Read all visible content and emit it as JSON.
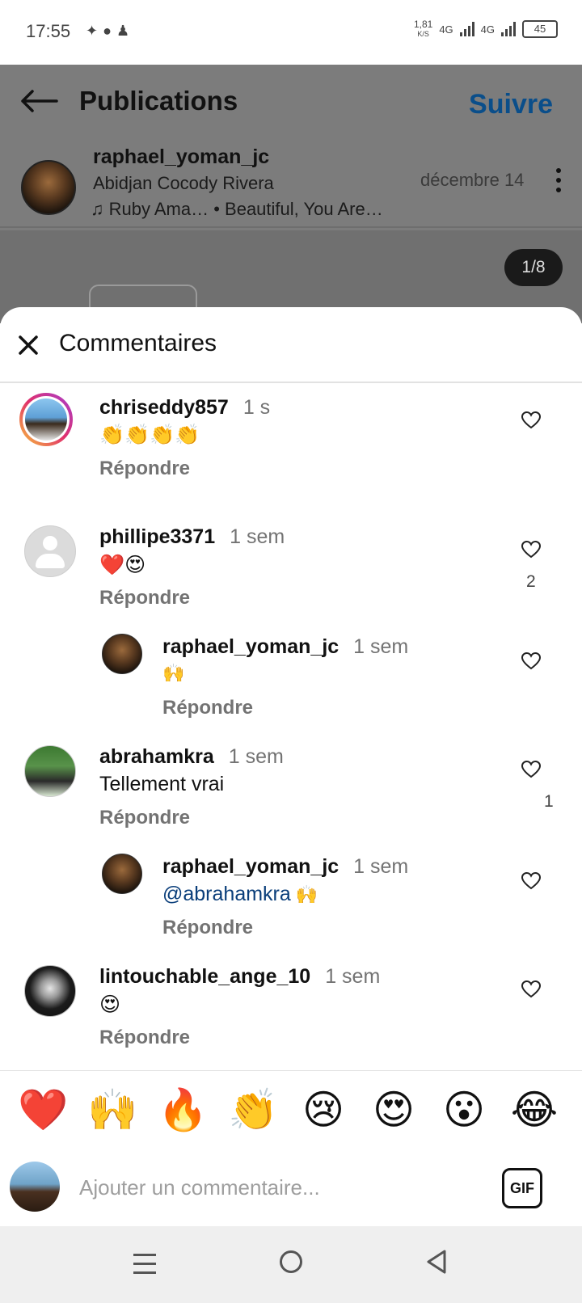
{
  "status_bar": {
    "time": "17:55",
    "left_icons": [
      "android-icon",
      "chat-bubble-icon",
      "snapchat-icon"
    ],
    "speed_value": "1,81",
    "speed_unit": "K/S",
    "network1": "4G",
    "network2": "4G",
    "battery": "45"
  },
  "header": {
    "title": "Publications",
    "follow_label": "Suivre"
  },
  "post": {
    "username": "raphael_yoman_jc",
    "location": "Abidjan Cocody Rivera",
    "music": "♫ Ruby Ama…  •  Beautiful, You Are…",
    "date": "décembre 14",
    "page_indicator": "1/8"
  },
  "comments_sheet": {
    "title": "Commentaires",
    "reply_label": "Répondre",
    "comments": [
      {
        "user": "chriseddy857",
        "time": "1 s",
        "text": "👏👏👏👏",
        "likes": ""
      },
      {
        "user": "phillipe3371",
        "time": "1 sem",
        "text": "❤️😍",
        "likes": "2"
      },
      {
        "user": "raphael_yoman_jc",
        "time": "1 sem",
        "text": "🙌",
        "likes": ""
      },
      {
        "user": "abrahamkra",
        "time": "1 sem",
        "text": "Tellement vrai",
        "likes": "1"
      },
      {
        "user": "raphael_yoman_jc",
        "time": "1 sem",
        "mention": "@abrahamkra",
        "text": " 🙌",
        "likes": ""
      },
      {
        "user": "lintouchable_ange_10",
        "time": "1 sem",
        "text": "😍",
        "likes": ""
      }
    ]
  },
  "emoji_bar": [
    "❤️",
    "🙌",
    "🔥",
    "👏",
    "😢",
    "😍",
    "😮",
    "😂"
  ],
  "comment_input": {
    "placeholder": "Ajouter un commentaire...",
    "gif_label": "GIF"
  },
  "colors": {
    "link_blue": "#0a4e8a",
    "dim_overlay": "#7c7c7c",
    "muted_text": "#737373"
  }
}
